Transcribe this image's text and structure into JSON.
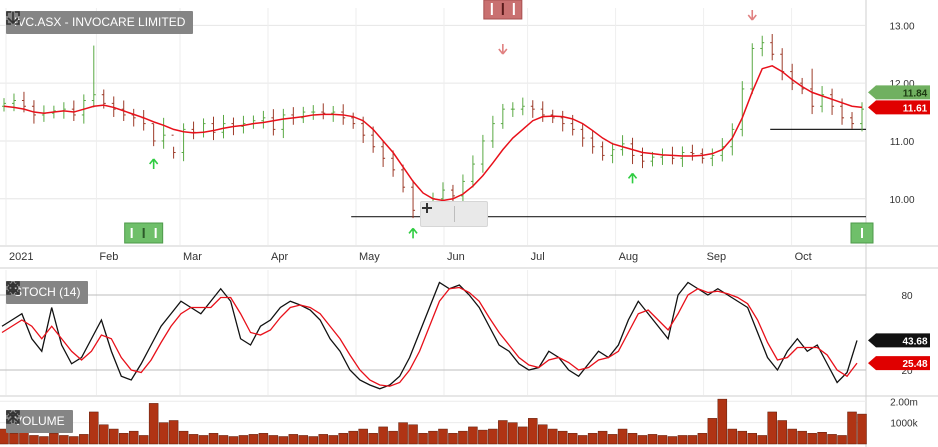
{
  "toolbar": {
    "main_title": "IVC.ASX - INVOCARE LIMITED",
    "stoch_title": "STOCH (14)",
    "volume_title": "VOLUME"
  },
  "colors": {
    "up_bar": "#59a843",
    "down_bar": "#9c3a28",
    "ma_line": "#e8101a",
    "stoch_k": "#111111",
    "stoch_d": "#e8101a",
    "volume_bar": "#b03414",
    "buy_marker": "#2ecc40",
    "sell_marker": "#e08080",
    "last_price_label": "#70b060",
    "ma_price_label": "#e00000"
  },
  "chart_data": [
    {
      "type": "line",
      "panel": "price",
      "x_axis_labels": [
        "2021",
        "Feb",
        "Mar",
        "Apr",
        "May",
        "Jun",
        "Jul",
        "Aug",
        "Sep",
        "Oct"
      ],
      "y_ticks": [
        "13.00",
        "12.00",
        "11.00",
        "10.00"
      ],
      "ylim": [
        9.2,
        13.3
      ],
      "grid": true,
      "series": [
        {
          "values": [
            11.6,
            11.58,
            11.55,
            11.5,
            11.48,
            11.5,
            11.52,
            11.5,
            11.55,
            11.6,
            11.62,
            11.58,
            11.52,
            11.46,
            11.4,
            11.33,
            11.27,
            11.2,
            11.16,
            11.14,
            11.15,
            11.18,
            11.22,
            11.25,
            11.27,
            11.3,
            11.32,
            11.35,
            11.38,
            11.4,
            11.42,
            11.45,
            11.46,
            11.46,
            11.45,
            11.42,
            11.35,
            11.2,
            11.0,
            10.8,
            10.55,
            10.3,
            10.1,
            10.0,
            9.97,
            10.0,
            10.08,
            10.22,
            10.4,
            10.62,
            10.85,
            11.05,
            11.2,
            11.35,
            11.42,
            11.43,
            11.42,
            11.38,
            11.3,
            11.18,
            11.05,
            10.95,
            10.9,
            10.85,
            10.8,
            10.78,
            10.76,
            10.75,
            10.74,
            10.74,
            10.75,
            10.78,
            10.85,
            11.05,
            11.4,
            11.85,
            12.25,
            12.3,
            12.2,
            12.06,
            11.94,
            11.84,
            11.78,
            11.72,
            11.66,
            11.6,
            11.58
          ]
        }
      ],
      "price_bars": {
        "close": [
          11.65,
          11.7,
          11.6,
          11.45,
          11.48,
          11.52,
          11.55,
          11.45,
          11.7,
          11.8,
          11.65,
          11.55,
          11.45,
          11.4,
          11.3,
          11.0,
          11.1,
          10.8,
          11.2,
          11.15,
          11.3,
          11.15,
          11.3,
          11.25,
          11.3,
          11.35,
          11.4,
          11.2,
          11.45,
          11.4,
          11.5,
          11.5,
          11.48,
          11.5,
          11.4,
          11.3,
          11.1,
          10.9,
          10.7,
          10.5,
          10.2,
          9.8,
          9.7,
          10.0,
          10.15,
          10.05,
          10.3,
          10.6,
          11.0,
          11.3,
          11.55,
          11.55,
          11.6,
          11.55,
          11.45,
          11.4,
          11.3,
          11.2,
          11.05,
          10.9,
          10.75,
          10.85,
          10.95,
          10.75,
          10.65,
          10.72,
          10.75,
          10.7,
          10.8,
          10.78,
          10.7,
          10.75,
          10.9,
          11.2,
          11.9,
          12.6,
          12.7,
          12.5,
          12.2,
          12.0,
          11.9,
          11.6,
          11.8,
          11.6,
          11.4,
          11.3,
          11.55
        ],
        "open": [
          11.6,
          11.65,
          11.7,
          11.6,
          11.45,
          11.48,
          11.52,
          11.55,
          11.45,
          11.7,
          11.8,
          11.65,
          11.55,
          11.45,
          11.4,
          11.3,
          11.0,
          11.1,
          10.8,
          11.2,
          11.15,
          11.3,
          11.15,
          11.3,
          11.25,
          11.3,
          11.35,
          11.4,
          11.2,
          11.45,
          11.4,
          11.5,
          11.5,
          11.48,
          11.5,
          11.4,
          11.3,
          11.1,
          10.9,
          10.7,
          10.5,
          10.2,
          9.8,
          9.7,
          10.0,
          10.15,
          10.05,
          10.3,
          10.6,
          11.0,
          11.3,
          11.55,
          11.55,
          11.6,
          11.55,
          11.45,
          11.4,
          11.3,
          11.2,
          11.05,
          10.9,
          10.75,
          10.85,
          10.95,
          10.75,
          10.65,
          10.72,
          10.75,
          10.7,
          10.8,
          10.78,
          10.7,
          10.75,
          10.9,
          11.2,
          11.9,
          12.6,
          12.7,
          12.5,
          12.2,
          12.0,
          11.9,
          11.6,
          11.8,
          11.6,
          11.4,
          11.3
        ],
        "spike_high": {
          "9": 12.65,
          "15": 11.3,
          "16": 11.4,
          "17": 10.9,
          "81": 12.25,
          "85": 11.5
        }
      },
      "support_lines": [
        {
          "value": 9.69,
          "from_bar": 35
        },
        {
          "value": 11.2,
          "from_bar": 77
        }
      ],
      "buy_markers": [
        15,
        41,
        63
      ],
      "sell_markers": [
        50,
        75
      ],
      "event_markers_bottom": [
        14,
        86
      ],
      "event_markers_top": [
        50
      ],
      "last_price_label": "11.84",
      "ma_price_label": "11.61"
    },
    {
      "type": "line",
      "panel": "stochastic",
      "title": "STOCH (14)",
      "y_ticks": [
        "80",
        "20"
      ],
      "ylim": [
        0,
        100
      ],
      "grid": true,
      "series": [
        {
          "name": "%K",
          "values": [
            55,
            60,
            65,
            45,
            35,
            70,
            40,
            25,
            30,
            45,
            60,
            35,
            15,
            12,
            25,
            40,
            55,
            65,
            75,
            70,
            65,
            75,
            85,
            75,
            45,
            40,
            55,
            60,
            70,
            75,
            72,
            68,
            60,
            45,
            35,
            20,
            12,
            8,
            5,
            8,
            15,
            30,
            50,
            70,
            90,
            85,
            88,
            80,
            70,
            55,
            40,
            35,
            25,
            20,
            22,
            35,
            30,
            20,
            15,
            25,
            35,
            30,
            40,
            60,
            75,
            65,
            55,
            45,
            80,
            90,
            85,
            80,
            85,
            80,
            75,
            70,
            50,
            30,
            20,
            35,
            45,
            35,
            40,
            25,
            10,
            18,
            43.68
          ]
        },
        {
          "name": "%D",
          "values": [
            50,
            55,
            60,
            55,
            45,
            55,
            45,
            35,
            28,
            35,
            48,
            45,
            30,
            20,
            18,
            28,
            42,
            55,
            65,
            70,
            70,
            70,
            78,
            78,
            65,
            50,
            48,
            52,
            62,
            70,
            72,
            70,
            65,
            55,
            45,
            32,
            20,
            12,
            8,
            7,
            10,
            20,
            35,
            55,
            75,
            85,
            86,
            82,
            75,
            62,
            50,
            40,
            30,
            24,
            22,
            28,
            30,
            26,
            20,
            22,
            28,
            30,
            35,
            50,
            65,
            68,
            60,
            52,
            65,
            80,
            85,
            82,
            83,
            81,
            78,
            73,
            60,
            42,
            28,
            30,
            38,
            38,
            38,
            32,
            20,
            15,
            25.48
          ]
        }
      ],
      "k_label": "43.68",
      "d_label": "25.48"
    },
    {
      "type": "bar",
      "panel": "volume",
      "title": "VOLUME",
      "y_ticks": [
        "2.00m",
        "1000k"
      ],
      "ylim": [
        0,
        2200000
      ],
      "values": [
        700000,
        500000,
        600000,
        400000,
        350000,
        500000,
        400000,
        350000,
        450000,
        1500000,
        900000,
        700000,
        500000,
        600000,
        400000,
        1900000,
        1000000,
        1100000,
        600000,
        450000,
        400000,
        500000,
        400000,
        350000,
        400000,
        450000,
        500000,
        400000,
        350000,
        450000,
        400000,
        350000,
        450000,
        400000,
        500000,
        600000,
        700000,
        500000,
        800000,
        600000,
        1000000,
        900000,
        500000,
        600000,
        700000,
        500000,
        600000,
        800000,
        650000,
        700000,
        1100000,
        1000000,
        800000,
        1200000,
        900000,
        700000,
        600000,
        500000,
        400000,
        500000,
        600000,
        450000,
        700000,
        500000,
        400000,
        450000,
        400000,
        350000,
        400000,
        400000,
        500000,
        1200000,
        2100000,
        700000,
        600000,
        500000,
        400000,
        1500000,
        1100000,
        700000,
        600000,
        500000,
        550000,
        450000,
        400000,
        1500000,
        1400000
      ]
    }
  ]
}
